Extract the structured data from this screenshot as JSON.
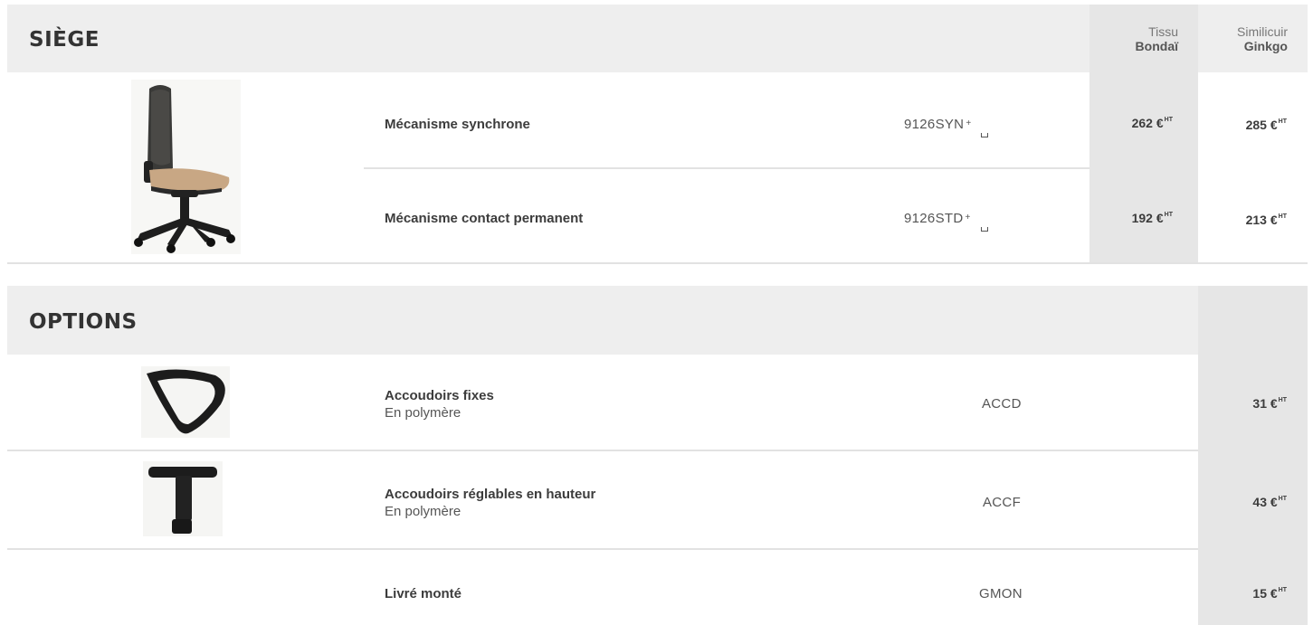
{
  "siege": {
    "title": "SIÈGE",
    "columns": [
      {
        "label": "Tissu",
        "name": "Bondaï"
      },
      {
        "label": "Similicuir",
        "name": "Ginkgo"
      }
    ],
    "rows": [
      {
        "title": "Mécanisme synchrone",
        "ref": "9126SYN",
        "ref_suffix": "+",
        "price_tissu": "262 €",
        "price_simili": "285 €",
        "unit": "HT"
      },
      {
        "title": "Mécanisme contact permanent",
        "ref": "9126STD",
        "ref_suffix": "+",
        "price_tissu": "192 €",
        "price_simili": "213 €",
        "unit": "HT"
      }
    ]
  },
  "options": {
    "title": "OPTIONS",
    "rows": [
      {
        "title": "Accoudoirs fixes",
        "subtitle": "En polymère",
        "ref": "ACCD",
        "price": "31 €",
        "unit": "HT"
      },
      {
        "title": "Accoudoirs réglables en hauteur",
        "subtitle": "En polymère",
        "ref": "ACCF",
        "price": "43 €",
        "unit": "HT"
      },
      {
        "title": "Livré monté",
        "subtitle": "",
        "ref": "GMON",
        "price": "15 €",
        "unit": "HT"
      }
    ]
  },
  "colors": {
    "band": "#eeeeee",
    "price_column": "#e6e6e6",
    "text": "#3a3a3a"
  }
}
